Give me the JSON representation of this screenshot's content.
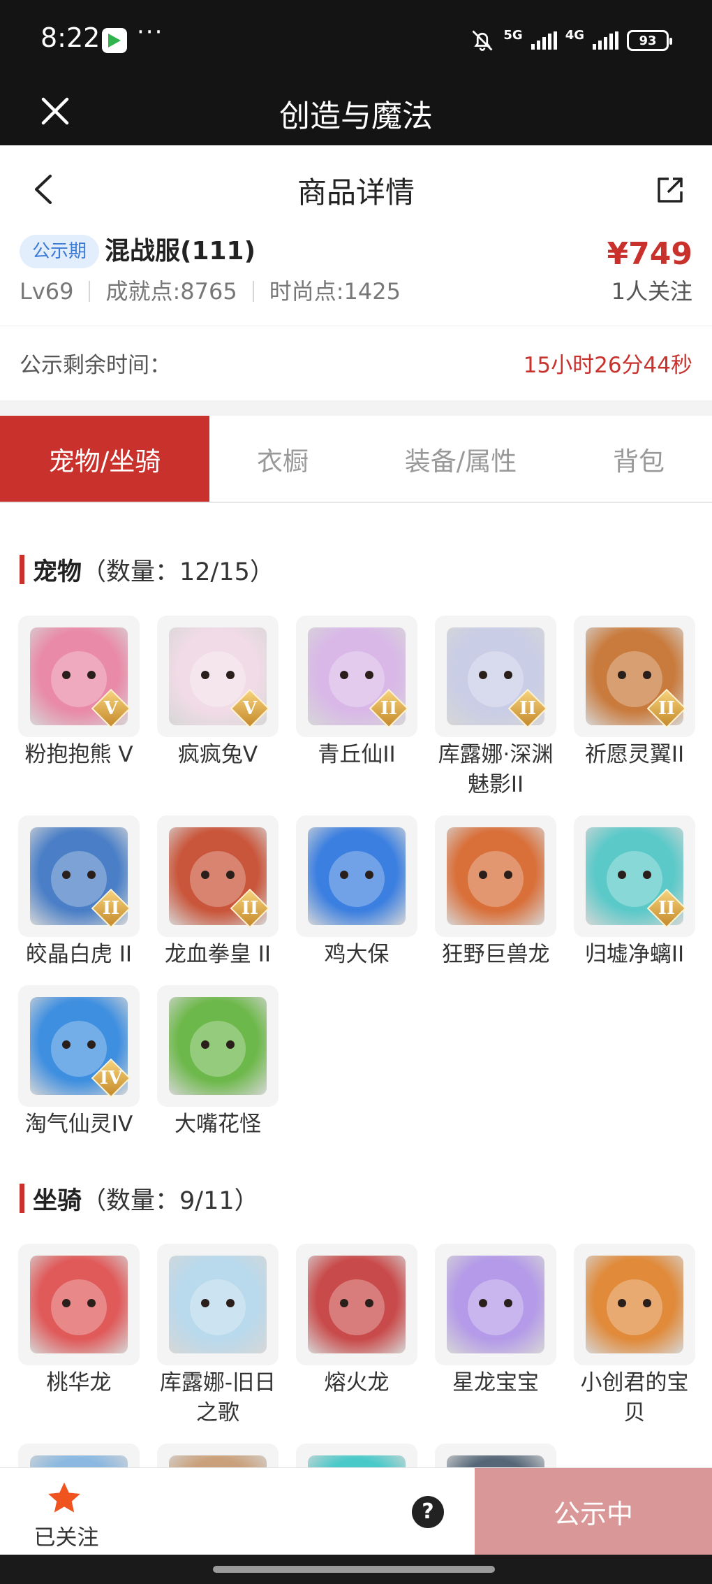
{
  "status_bar": {
    "time": "8:22",
    "dots": "···",
    "net1": "5G",
    "net2": "4G",
    "battery": "93"
  },
  "title_bar": {
    "title": "创造与魔法"
  },
  "page": {
    "title": "商品详情"
  },
  "product": {
    "badge": "公示期",
    "server": "混战服(111)",
    "price": "¥749",
    "level": "Lv69",
    "achievement": "成就点:8765",
    "fashion": "时尚点:1425",
    "followers": "1人关注"
  },
  "countdown": {
    "label": "公示剩余时间：",
    "value": "15小时26分44秒"
  },
  "tabs": [
    {
      "label": "宠物/坐骑",
      "active": true
    },
    {
      "label": "衣橱",
      "active": false
    },
    {
      "label": "装备/属性",
      "active": false
    },
    {
      "label": "背包",
      "active": false
    }
  ],
  "pets": {
    "name": "宠物",
    "count": "（数量：12/15）",
    "items": [
      {
        "name": "粉抱抱熊 V",
        "grade": "V",
        "color": "#e98aa8"
      },
      {
        "name": "疯疯兔V",
        "grade": "V",
        "color": "#f1dbe6"
      },
      {
        "name": "青丘仙II",
        "grade": "II",
        "color": "#d9b8e8"
      },
      {
        "name": "库露娜·深渊魅影II",
        "grade": "II",
        "color": "#c9cde6"
      },
      {
        "name": "祈愿灵翼II",
        "grade": "II",
        "color": "#c97b3d"
      },
      {
        "name": "皎晶白虎 II",
        "grade": "II",
        "color": "#4a7fc7"
      },
      {
        "name": "龙血拳皇 II",
        "grade": "II",
        "color": "#c9553a"
      },
      {
        "name": "鸡大保",
        "grade": "",
        "color": "#3b7fe0"
      },
      {
        "name": "狂野巨兽龙",
        "grade": "",
        "color": "#d9703a"
      },
      {
        "name": "归墟净螭II",
        "grade": "II",
        "color": "#5cc9c9"
      },
      {
        "name": "淘气仙灵IV",
        "grade": "IV",
        "color": "#3f8fe0"
      },
      {
        "name": "大嘴花怪",
        "grade": "",
        "color": "#6db84a"
      }
    ]
  },
  "mounts": {
    "name": "坐骑",
    "count": "（数量：9/11）",
    "items": [
      {
        "name": "桃华龙",
        "color": "#e05a5a"
      },
      {
        "name": "库露娜-旧日之歌",
        "color": "#b9d9ec"
      },
      {
        "name": "熔火龙",
        "color": "#c94a4a"
      },
      {
        "name": "星龙宝宝",
        "color": "#b49ae8"
      },
      {
        "name": "小创君的宝贝",
        "color": "#e08a3a"
      },
      {
        "name": "",
        "color": "#8ab8e0"
      },
      {
        "name": "",
        "color": "#c9a07a"
      },
      {
        "name": "",
        "color": "#4ac9c9"
      },
      {
        "name": "",
        "color": "#556677"
      }
    ]
  },
  "bottom": {
    "follow_label": "已关注",
    "help": "?",
    "status_button": "公示中"
  },
  "colors": {
    "accent": "#c8312c",
    "badge_bg": "#e3eefc",
    "badge_text": "#3a7bd5",
    "status_button": "#d99797"
  }
}
